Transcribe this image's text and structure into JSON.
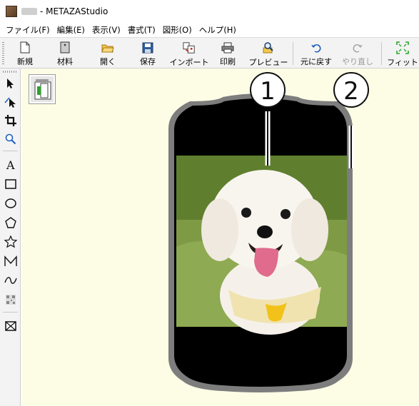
{
  "window": {
    "title": "- METAZAStudio"
  },
  "menu": [
    "ファイル(F)",
    "編集(E)",
    "表示(V)",
    "書式(T)",
    "図形(O)",
    "ヘルプ(H)"
  ],
  "toolbar": {
    "new": "新規",
    "material": "材料",
    "open": "開く",
    "save": "保存",
    "import": "インポート",
    "print": "印刷",
    "preview": "プレビュー",
    "undo": "元に戻す",
    "redo": "やり直し",
    "fit": "フィット"
  },
  "tools": [
    "select-arrow-icon",
    "node-edit-icon",
    "crop-icon",
    "zoom-icon",
    "text-icon",
    "rectangle-icon",
    "ellipse-icon",
    "pentagon-icon",
    "star-icon",
    "polyline-icon",
    "curve-icon",
    "qr-code-icon",
    "image-frame-icon"
  ],
  "annotations": {
    "callout_1": "1",
    "callout_2": "2"
  },
  "colors": {
    "canvas_bg": "#fdfde6",
    "tag_outline": "#7a7a7a",
    "tag_fill": "#000000",
    "selection_green": "#2aa52a"
  }
}
